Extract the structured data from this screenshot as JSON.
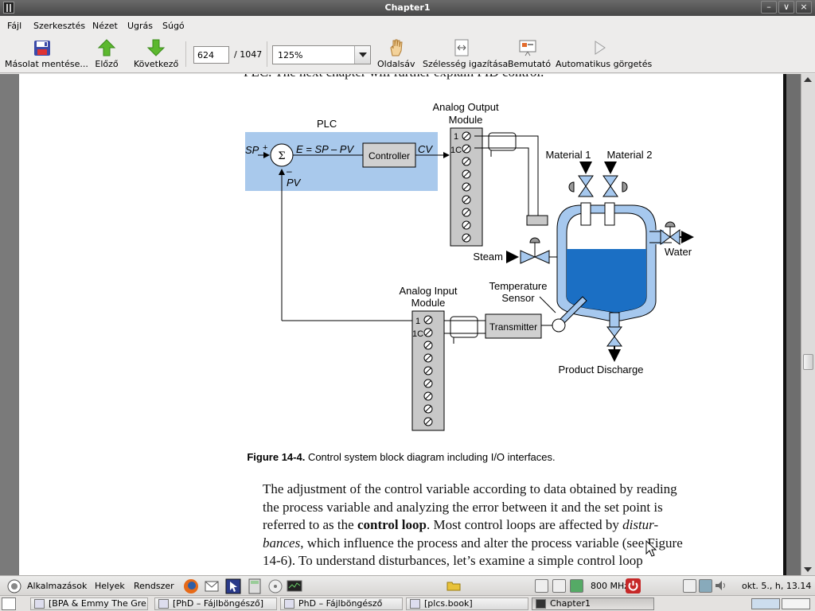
{
  "window": {
    "title": "Chapter1",
    "buttons": [
      "–",
      "∨",
      "×"
    ]
  },
  "menu": [
    "Fájl",
    "Szerkesztés",
    "Nézet",
    "Ugrás",
    "Súgó"
  ],
  "toolbar": {
    "save_copy": "Másolat mentése...",
    "prev": "Előző",
    "next": "Következő",
    "page_value": "624",
    "page_total": "/ 1047",
    "zoom": "125%",
    "sidebar": "Oldalsáv",
    "fit_width": "Szélesség igazítása",
    "presentation": "Bemutató",
    "autoscroll": "Automatikus görgetés"
  },
  "document": {
    "top_partial": "PLC. The next chapter will further explain PID control.",
    "figure": {
      "plc": "PLC",
      "sp": "SP",
      "plus": "+",
      "minus": "–",
      "sigma": "Σ",
      "error_eq": "E = SP – PV",
      "controller": "Controller",
      "cv": "CV",
      "pv": "PV",
      "ao_module_1": "Analog Output",
      "ao_module_2": "Module",
      "ai_module_1": "Analog Input",
      "ai_module_2": "Module",
      "term_1": "1",
      "term_1c": "1C",
      "material1": "Material 1",
      "material2": "Material 2",
      "steam": "Steam",
      "water": "Water",
      "temp_sensor_1": "Temperature",
      "temp_sensor_2": "Sensor",
      "transmitter": "Transmitter",
      "product_discharge": "Product Discharge"
    },
    "caption_bold": "Figure 14-4.",
    "caption_rest": " Control system block diagram including I/O interfaces.",
    "para1": "The adjustment of the control variable according to data obtained by reading",
    "para2": "the process variable and analyzing the error between it and the set point is",
    "para3_a": "referred to as the ",
    "para3_b": "control loop",
    "para3_c": ". Most control loops are affected by ",
    "para3_d": "distur-",
    "para4_a": "bances",
    "para4_b": ", which influence the process and alter the process variable (see Figure",
    "para5": "14-6). To understand disturbances, let’s examine a simple control loop"
  },
  "panel": {
    "applications": "Alkalmazások",
    "places": "Helyek",
    "system": "Rendszer",
    "cpu": "800 MHz",
    "clock": "okt.  5., h, 13.14"
  },
  "tasks": [
    {
      "label": "[BPA & Emmy The Gre..."
    },
    {
      "label": "[PhD – Fájlböngésző]"
    },
    {
      "label": "PhD – Fájlböngésző"
    },
    {
      "label": "[plcs.book]"
    },
    {
      "label": "Chapter1"
    }
  ],
  "colors": {
    "plc_box": "#a9c9ec",
    "vessel": "#1b6fc4",
    "vessel_outer": "#a6c8ee"
  }
}
